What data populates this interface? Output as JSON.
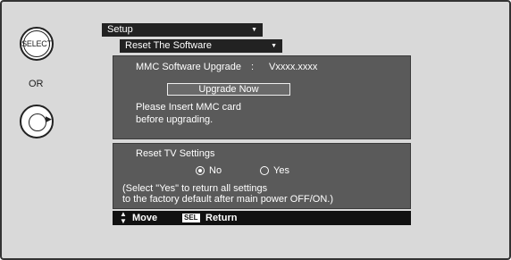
{
  "controls": {
    "select_label": "SELECT",
    "or_label": "OR"
  },
  "menu": {
    "top_dropdown": "Setup",
    "sub_dropdown": "Reset The Software"
  },
  "software": {
    "label": "MMC Software Upgrade",
    "separator": ":",
    "version": "Vxxxx.xxxx",
    "button_label": "Upgrade Now",
    "instruction_line1": "Please Insert MMC card",
    "instruction_line2": "before upgrading."
  },
  "reset_tv": {
    "title": "Reset TV Settings",
    "options": [
      {
        "label": "No",
        "selected": true
      },
      {
        "label": "Yes",
        "selected": false
      }
    ],
    "note_line1": "(Select \"Yes\" to return all settings",
    "note_line2": "to the factory default after main power OFF/ON.)"
  },
  "footer": {
    "move_label": "Move",
    "sel_key": "SEL",
    "return_label": "Return"
  },
  "colors": {
    "panel": "#5a5a5a",
    "dropdown": "#222222",
    "footer": "#111111",
    "background": "#d9d9d9"
  }
}
